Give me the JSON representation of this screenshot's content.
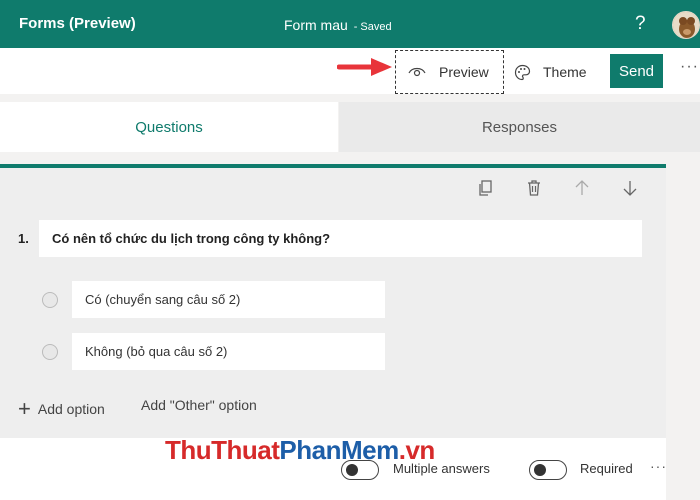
{
  "header": {
    "app_title": "Forms (Preview)",
    "form_name": "Form mau",
    "save_status": "- Saved",
    "help_label": "?"
  },
  "toolbar": {
    "preview_label": "Preview",
    "theme_label": "Theme",
    "send_label": "Send",
    "more_label": "···"
  },
  "tabs": [
    {
      "label": "Questions",
      "active": true
    },
    {
      "label": "Responses",
      "active": false
    }
  ],
  "question": {
    "number": "1.",
    "title": "Có nên tổ chức du lịch trong công ty không?",
    "options": [
      "Có (chuyển sang câu số 2)",
      "Không (bỏ qua câu số 2)"
    ],
    "add_option_label": "Add option",
    "add_other_label": "Add \"Other\" option"
  },
  "settings": {
    "multiple_answers_label": "Multiple answers",
    "required_label": "Required",
    "more_label": "···"
  },
  "watermark": {
    "part1": "ThuThuat",
    "part2": "PhanMem",
    "part3": ".vn"
  },
  "colors": {
    "brand": "#0f7b6c",
    "annotation_arrow": "#e8343a"
  }
}
